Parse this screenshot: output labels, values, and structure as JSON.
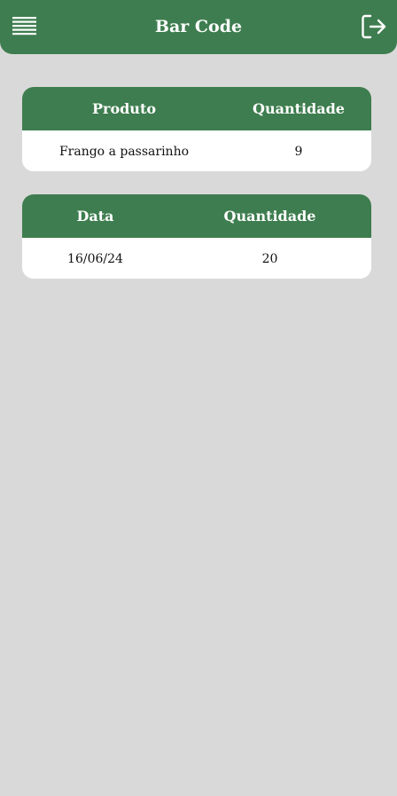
{
  "header": {
    "title": "Bar Code",
    "menu_icon": "hamburger-menu-icon",
    "logout_icon": "logout-icon",
    "color": "#3e7d4f"
  },
  "product_table": {
    "headers": [
      "Produto",
      "Quantidade"
    ],
    "rows": [
      [
        "Frango a passarinho",
        "9"
      ]
    ]
  },
  "date_table": {
    "headers": [
      "Data",
      "Quantidade"
    ],
    "rows": [
      [
        "16/06/24",
        "20"
      ]
    ]
  },
  "colors": {
    "background": "#d9d9d9",
    "accent": "#3e7d4f",
    "card": "#ffffff"
  }
}
